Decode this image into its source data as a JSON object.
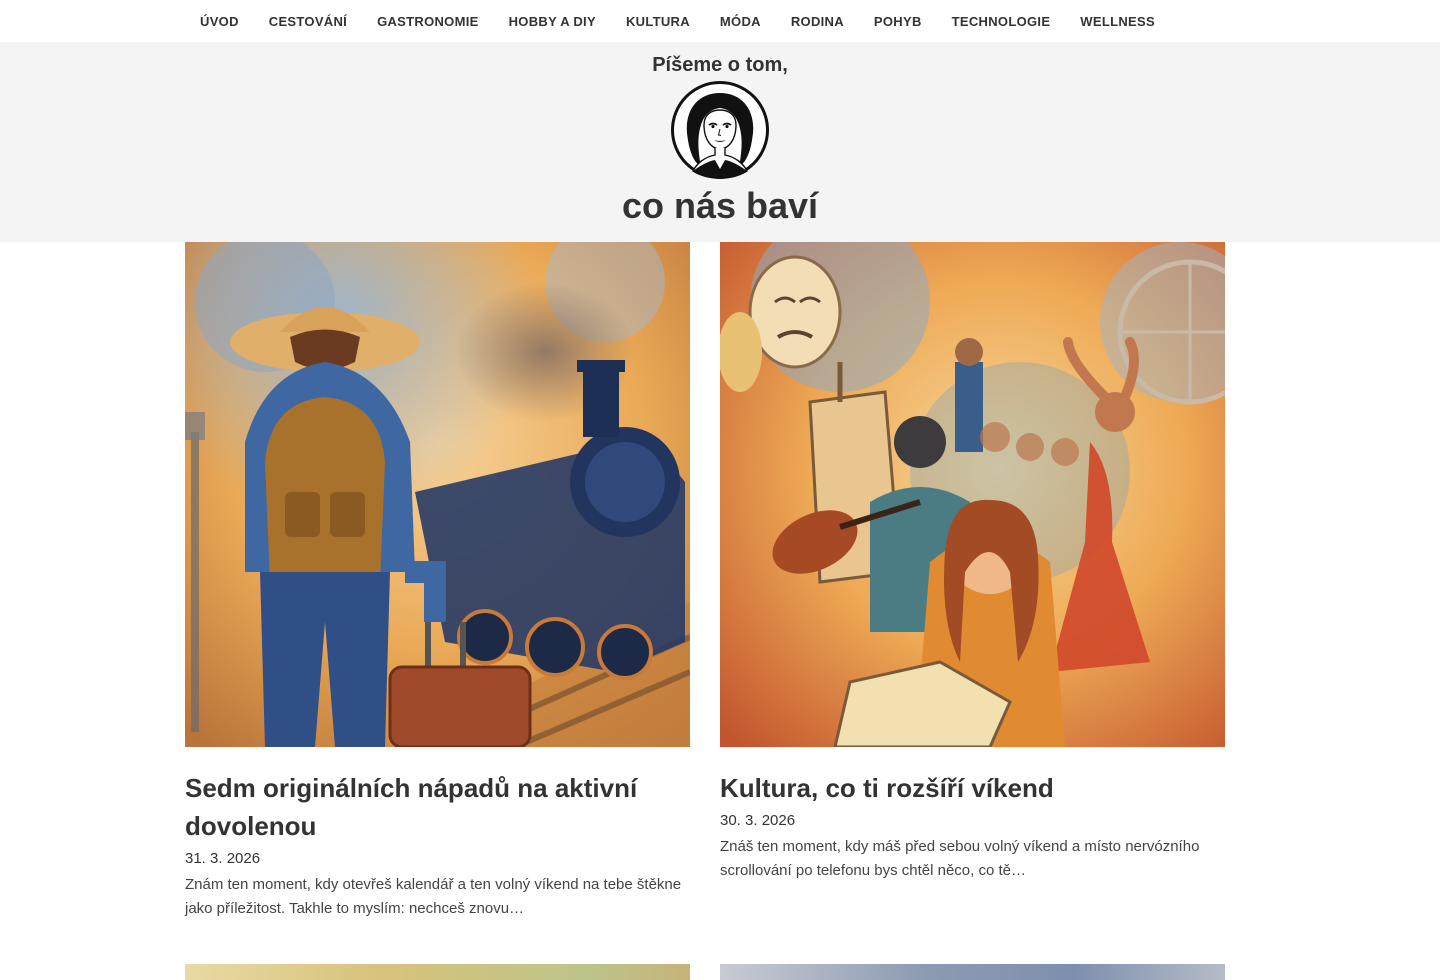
{
  "nav": {
    "items": [
      {
        "label": "ÚVOD"
      },
      {
        "label": "CESTOVÁNÍ"
      },
      {
        "label": "GASTRONOMIE"
      },
      {
        "label": "HOBBY A DIY"
      },
      {
        "label": "KULTURA"
      },
      {
        "label": "MÓDA"
      },
      {
        "label": "RODINA"
      },
      {
        "label": "POHYB"
      },
      {
        "label": "TECHNOLOGIE"
      },
      {
        "label": "WELLNESS"
      }
    ]
  },
  "header": {
    "tagline_top": "Píšeme o tom,",
    "tagline_bottom": "co nás baví",
    "logo_icon": "woman-portrait-logo",
    "background": "#f4f4f4"
  },
  "posts": [
    {
      "title": "Sedm originálních nápadů na aktivní dovolenou",
      "date": "31. 3. 2026",
      "excerpt": "Znám ten moment, kdy otevřeš kalendář a ten volný víkend na tebe štěkne jako příležitost. Takhle to myslím: nechceš znovu…",
      "image_icon": "traveler-train-watercolor"
    },
    {
      "title": "Kultura, co ti rozšíří víkend",
      "date": "30. 3. 2026",
      "excerpt": "Znáš ten moment, kdy máš před sebou volný víkend a místo nervózního scrollování po telefonu bys chtěl něco, co tě…",
      "image_icon": "culture-collage-watercolor"
    }
  ],
  "colors": {
    "text": "#333333",
    "header_bg": "#f4f4f4"
  }
}
